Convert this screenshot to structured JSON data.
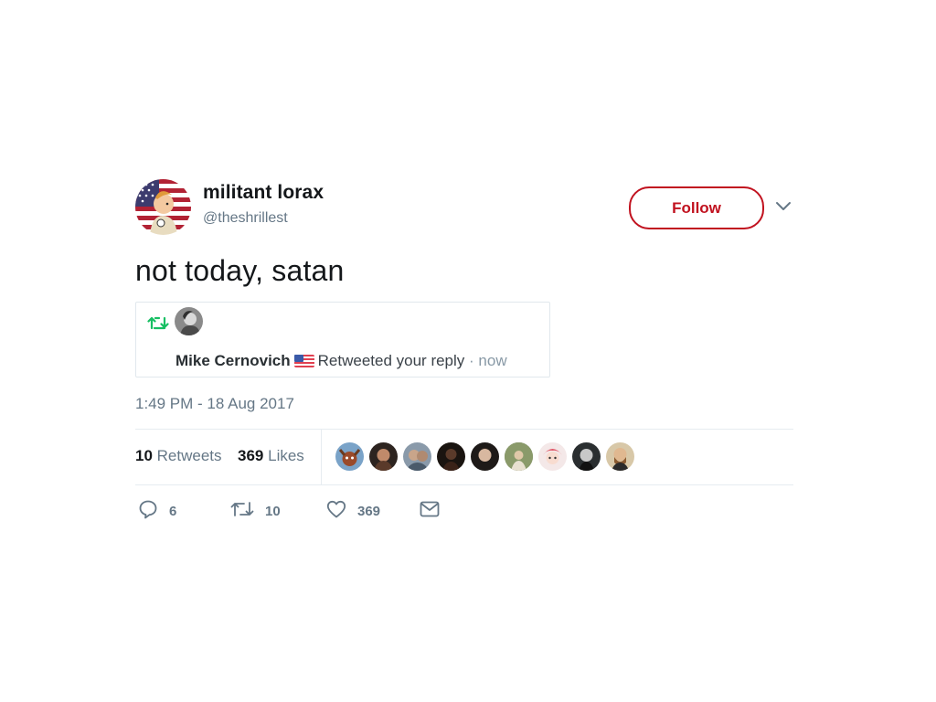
{
  "tweet": {
    "author": {
      "display_name": "militant lorax",
      "handle": "@theshrillest",
      "avatar_icon": "avatar-icon"
    },
    "follow_label": "Follow",
    "text": "not today, satan",
    "timestamp": "1:49 PM - 18 Aug 2017"
  },
  "embedded_notification": {
    "icon": "retweet-icon",
    "name": "Mike Cernovich",
    "flag_icon": "us-flag-icon",
    "action": "Retweeted your reply",
    "separator": " · ",
    "time": "now"
  },
  "stats": {
    "retweets_count": "10",
    "retweets_label": "Retweets",
    "likes_count": "369",
    "likes_label": "Likes",
    "liker_avatar_count": 9
  },
  "actions": {
    "reply_count": "6",
    "retweet_count": "10",
    "like_count": "369"
  },
  "colors": {
    "accent": "#c1121f",
    "retweet_green": "#17bf63",
    "muted": "#657786",
    "text": "#14171a",
    "border": "#e6ecf0"
  }
}
